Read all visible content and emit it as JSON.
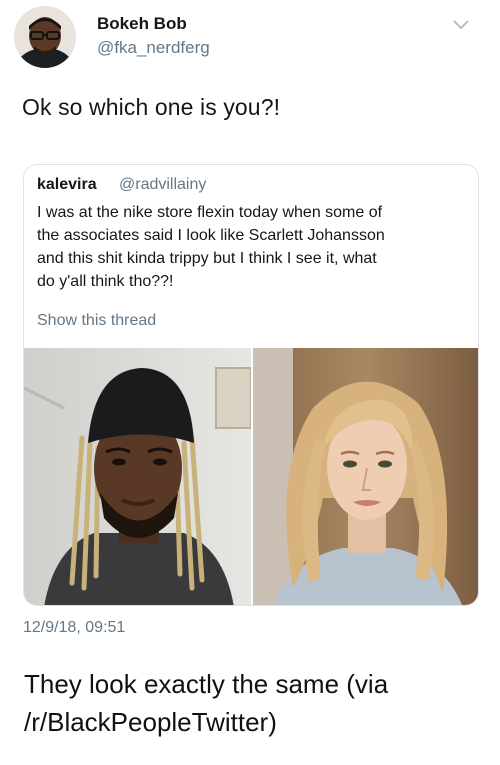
{
  "tweet": {
    "author": {
      "name": "Bokeh Bob",
      "handle": "@fka_nerdferg"
    },
    "text": "Ok so which one is you?!",
    "timestamp": "12/9/18, 09:51"
  },
  "quoted_tweet": {
    "author": {
      "name": "kalevira",
      "handle": "@radvillainy"
    },
    "lines": [
      "I was at the nike store flexin today when some of",
      "the associates said I look like Scarlett Johansson",
      "and this shit kinda trippy but I think I see it, what",
      "do y'all think tho??!"
    ],
    "show_thread": "Show this thread"
  },
  "caption": {
    "line1": "They look exactly the same (via",
    "line2": "/r/BlackPeopleTwitter)"
  },
  "icons": {
    "menu": "chevron-down-icon"
  },
  "colors": {
    "text": "#14171a",
    "secondary": "#657786",
    "border": "#dfe3e6"
  }
}
